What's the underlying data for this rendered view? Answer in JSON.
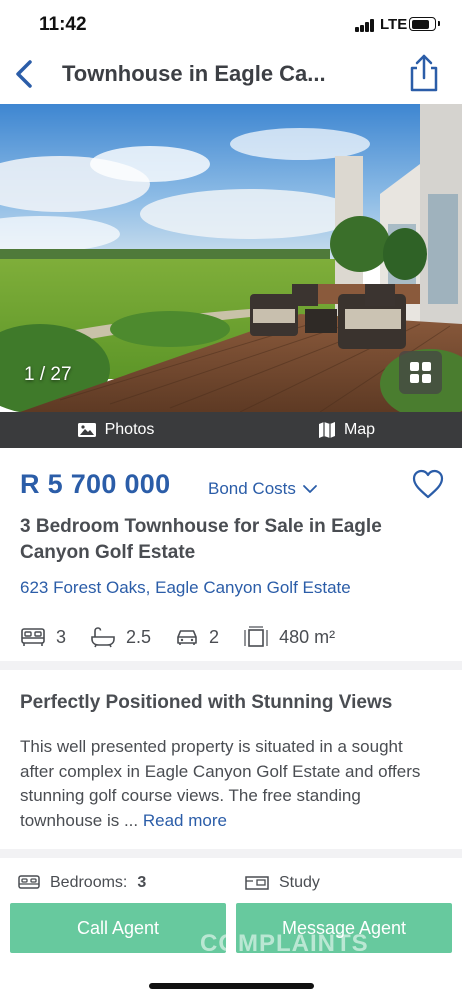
{
  "status_bar": {
    "time": "11:42",
    "network": "LTE",
    "icons": [
      "signal-bars-icon",
      "battery-icon"
    ]
  },
  "nav": {
    "title": "Townhouse in Eagle Ca...",
    "back_icon": "chevron-left-icon",
    "share_icon": "share-icon"
  },
  "gallery": {
    "counter": "1 / 27",
    "grid_icon": "grid-icon"
  },
  "media_tabs": [
    {
      "label": "Photos",
      "icon": "image-icon"
    },
    {
      "label": "Map",
      "icon": "map-icon"
    }
  ],
  "listing": {
    "price": "R 5 700 000",
    "bond_costs_label": "Bond Costs",
    "title": "3 Bedroom Townhouse for Sale in Eagle Canyon Golf Estate",
    "address": "623 Forest Oaks, Eagle Canyon Golf Estate",
    "features": {
      "bedrooms": "3",
      "bathrooms": "2.5",
      "garages": "2",
      "floor_size": "480 m²"
    }
  },
  "description": {
    "heading": "Perfectly Positioned with Stunning Views",
    "text": "This well presented property is situated in a sought after complex in Eagle Canyon Golf Estate and offers stunning golf course views. The free standing townhouse is ... ",
    "read_more": "Read more"
  },
  "details": {
    "bedrooms_label": "Bedrooms:",
    "bedrooms_value": "3",
    "study_label": "Study"
  },
  "actions": {
    "call_agent": "Call Agent",
    "message_agent": "Message Agent"
  },
  "watermark": "COMPLAINTS",
  "colors": {
    "brand_blue": "#2b5da8",
    "action_green": "#67c99e",
    "tab_bar": "#3a3b3d",
    "text": "#4a4d52"
  }
}
